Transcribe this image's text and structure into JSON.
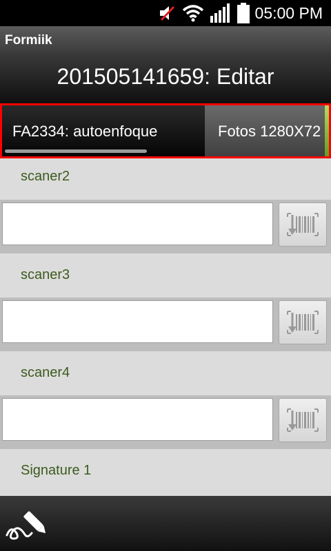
{
  "status_bar": {
    "time": "05:00 PM",
    "icons": [
      "mute-icon",
      "wifi-icon",
      "signal-icon",
      "battery-icon"
    ]
  },
  "app": {
    "title": "Formiik"
  },
  "header": {
    "title": "201505141659: Editar"
  },
  "tabs": [
    {
      "label": "FA2334: autoenfoque",
      "active": true
    },
    {
      "label": "Fotos 1280X72",
      "active": false
    }
  ],
  "fields": [
    {
      "label": "scaner2",
      "value": "",
      "button_icon": "barcode-scan-icon"
    },
    {
      "label": "scaner3",
      "value": "",
      "button_icon": "barcode-scan-icon"
    },
    {
      "label": "scaner4",
      "value": "",
      "button_icon": "barcode-scan-icon"
    }
  ],
  "signature": {
    "label": "Signature 1",
    "button_icon": "signature-pen-icon"
  },
  "colors": {
    "label_text": "#3d5a1e",
    "tab_highlight_border": "#ff0000",
    "tab_edge_accent": "#8fbf30"
  }
}
